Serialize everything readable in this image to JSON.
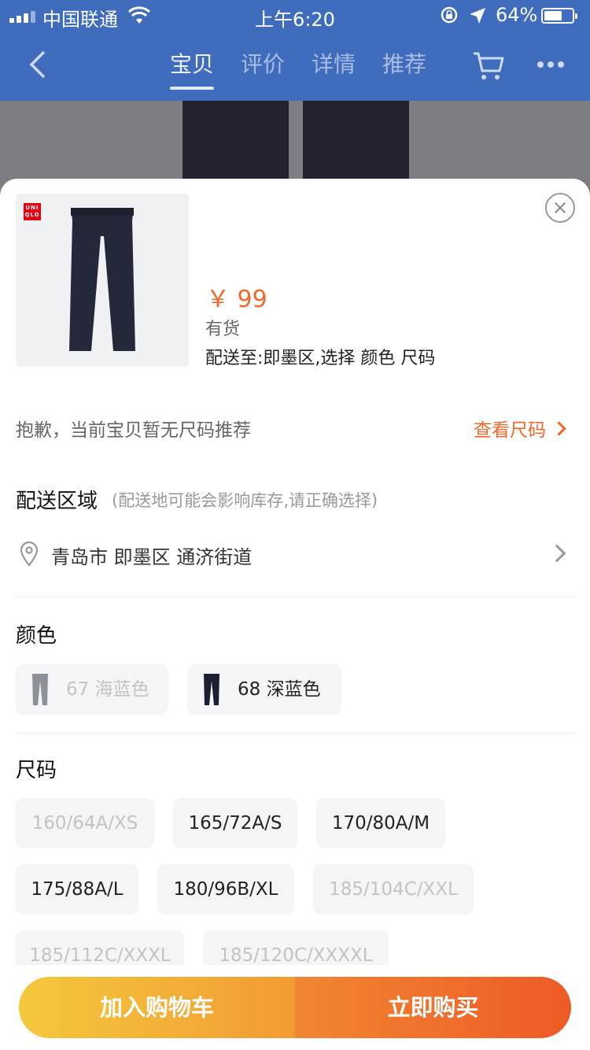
{
  "status_bar": {
    "carrier": "中国联通",
    "time": "上午6:20",
    "battery": "64%",
    "battery_level": 0.64
  },
  "nav": {
    "tabs": [
      {
        "label": "宝贝",
        "active": true
      },
      {
        "label": "评价",
        "active": false
      },
      {
        "label": "详情",
        "active": false
      },
      {
        "label": "推荐",
        "active": false
      }
    ],
    "icons": [
      "back-icon",
      "cart-icon",
      "more-icon"
    ]
  },
  "product": {
    "brand_logo": "UNIQLO",
    "price": "￥ 99",
    "stock": "有货",
    "ship_to": "配送至:即墨区,选择  颜色 尺码"
  },
  "sizing": {
    "note": "抱歉，当前宝贝暂无尺码推荐",
    "guide_link": "查看尺码"
  },
  "delivery": {
    "title": "配送区域",
    "hint": "(配送地可能会影响库存,请正确选择)",
    "address": "青岛市 即墨区 通济街道"
  },
  "color": {
    "title": "颜色",
    "options": [
      {
        "label": "67 海蓝色",
        "available": false,
        "swatch": "#8e9097"
      },
      {
        "label": "68 深蓝色",
        "available": true,
        "swatch": "#1d2030"
      }
    ]
  },
  "size": {
    "title": "尺码",
    "options": [
      {
        "label": "160/64A/XS",
        "available": false
      },
      {
        "label": "165/72A/S",
        "available": true
      },
      {
        "label": "170/80A/M",
        "available": true
      },
      {
        "label": "175/88A/L",
        "available": true
      },
      {
        "label": "180/96B/XL",
        "available": true
      },
      {
        "label": "185/104C/XXL",
        "available": false
      },
      {
        "label": "185/112C/XXXL",
        "available": false
      },
      {
        "label": "185/120C/XXXXL",
        "available": false
      }
    ]
  },
  "actions": {
    "add_to_cart": "加入购物车",
    "buy_now": "立即购买"
  },
  "colors": {
    "accent": "#f2682a",
    "nav_blue": "#3f6cbc",
    "cart_gradient": [
      "#f5c83d",
      "#f29b33"
    ],
    "buy_gradient": [
      "#f08731",
      "#ee5a26"
    ]
  }
}
